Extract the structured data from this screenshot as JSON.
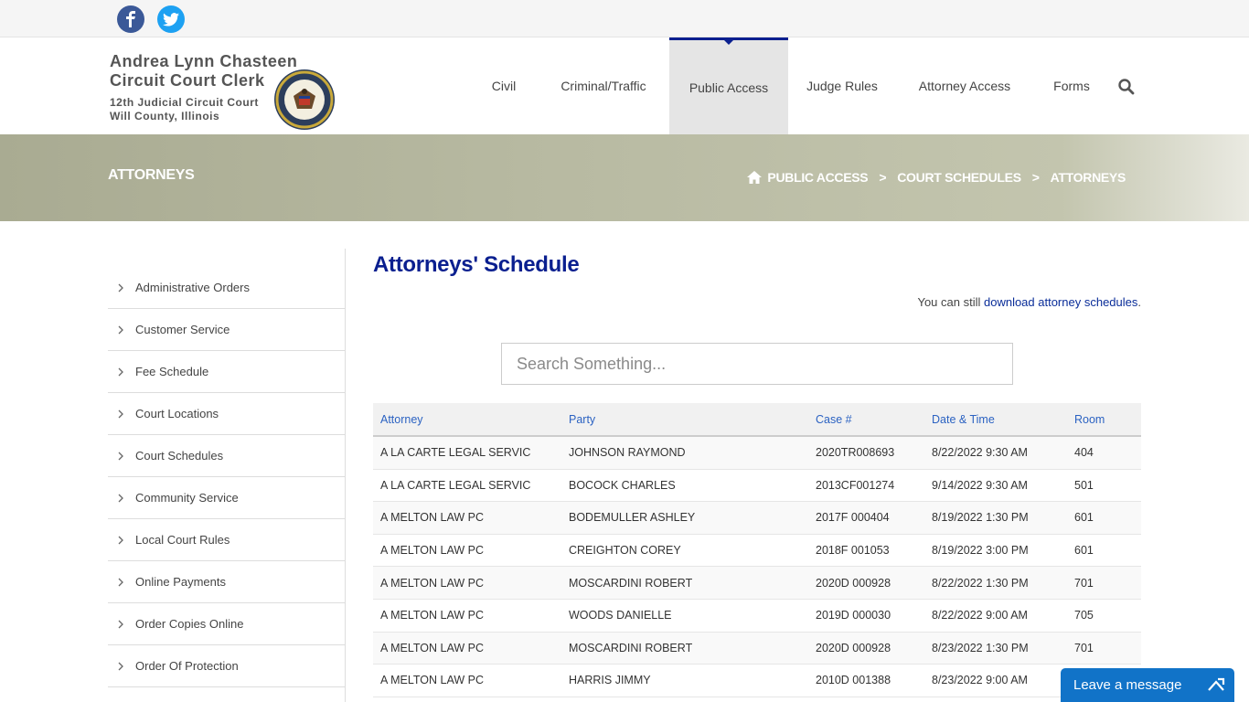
{
  "social": {
    "facebook_icon": "facebook-icon",
    "twitter_icon": "twitter-icon"
  },
  "logo": {
    "line1": "Andrea Lynn Chasteen",
    "line2": "Circuit Court Clerk",
    "line3": "12th Judicial Circuit Court",
    "line4": "Will County, Illinois"
  },
  "nav": {
    "items": [
      {
        "label": "Civil"
      },
      {
        "label": "Criminal/Traffic"
      },
      {
        "label": "Public Access",
        "active": true
      },
      {
        "label": "Judge Rules"
      },
      {
        "label": "Attorney Access"
      },
      {
        "label": "Forms"
      }
    ],
    "search_icon": "search-icon"
  },
  "banner": {
    "title": "ATTORNEYS",
    "breadcrumb": [
      "PUBLIC ACCESS",
      "COURT SCHEDULES",
      "ATTORNEYS"
    ],
    "separator": ">"
  },
  "sidebar": {
    "items": [
      {
        "label": "Administrative Orders"
      },
      {
        "label": "Customer Service"
      },
      {
        "label": "Fee Schedule"
      },
      {
        "label": "Court Locations"
      },
      {
        "label": "Court Schedules"
      },
      {
        "label": "Community Service"
      },
      {
        "label": "Local Court Rules"
      },
      {
        "label": "Online Payments"
      },
      {
        "label": "Order Copies Online"
      },
      {
        "label": "Order Of Protection"
      }
    ]
  },
  "main": {
    "title": "Attorneys' Schedule",
    "note_prefix": "You can still ",
    "note_link": "download attorney schedules",
    "note_suffix": ".",
    "search_placeholder": "Search Something..."
  },
  "table": {
    "headers": [
      "Attorney",
      "Party",
      "Case #",
      "Date & Time",
      "Room"
    ],
    "rows": [
      [
        "A LA CARTE LEGAL SERVIC",
        "JOHNSON RAYMOND",
        "2020TR008693",
        "8/22/2022 9:30 AM",
        "404"
      ],
      [
        "A LA CARTE LEGAL SERVIC",
        "BOCOCK CHARLES",
        "2013CF001274",
        "9/14/2022 9:30 AM",
        "501"
      ],
      [
        "A MELTON LAW PC",
        "BODEMULLER ASHLEY",
        "2017F 000404",
        "8/19/2022 1:30 PM",
        "601"
      ],
      [
        "A MELTON LAW PC",
        "CREIGHTON COREY",
        "2018F 001053",
        "8/19/2022 3:00 PM",
        "601"
      ],
      [
        "A MELTON LAW PC",
        "MOSCARDINI ROBERT",
        "2020D 000928",
        "8/22/2022 1:30 PM",
        "701"
      ],
      [
        "A MELTON LAW PC",
        "WOODS DANIELLE",
        "2019D 000030",
        "8/22/2022 9:00 AM",
        "705"
      ],
      [
        "A MELTON LAW PC",
        "MOSCARDINI ROBERT",
        "2020D 000928",
        "8/23/2022 1:30 PM",
        "701"
      ],
      [
        "A MELTON LAW PC",
        "HARRIS JIMMY",
        "2010D 001388",
        "8/23/2022 9:00 AM",
        ""
      ]
    ]
  },
  "chat": {
    "label": "Leave a message",
    "icon": "maximize-icon"
  },
  "colors": {
    "brand_blue": "#0a1f8f",
    "header_link": "#2b62c2",
    "chat_blue": "#1173c8"
  }
}
